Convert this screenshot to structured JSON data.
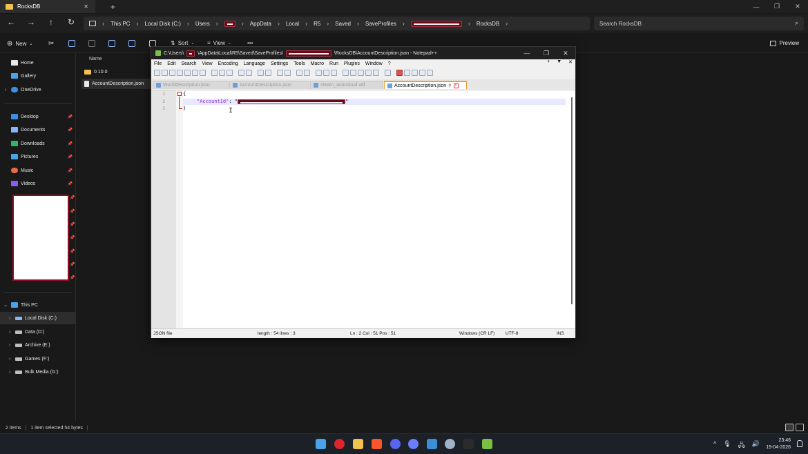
{
  "explorer": {
    "tab_title": "RocksDB",
    "tab_close": "✕",
    "new_tab": "+",
    "window_controls": {
      "minimize": "—",
      "maximize": "❐",
      "close": "✕"
    },
    "nav": {
      "back": "←",
      "forward": "→",
      "up": "↑",
      "refresh": "↻"
    },
    "breadcrumb": [
      "This PC",
      "Local Disk (C:)",
      "Users",
      "AppData",
      "Local",
      "R5",
      "Saved",
      "SaveProfiles",
      "RocksDB"
    ],
    "search_placeholder": "Search RocksDB",
    "toolbar": {
      "new_label": "New",
      "sort_label": "Sort",
      "view_label": "View",
      "more_label": "•••",
      "preview_label": "Preview"
    },
    "sidebar": {
      "quick": [
        {
          "label": "Home",
          "color": "#e8e8e8",
          "icon": "home-icon"
        },
        {
          "label": "Gallery",
          "color": "#4aa3e8",
          "icon": "gallery-icon"
        },
        {
          "label": "OneDrive",
          "color": "#3b8ee8",
          "icon": "cloud-icon"
        }
      ],
      "pinned": [
        {
          "label": "Desktop",
          "color": "#3b8ee8",
          "icon": "desktop-icon"
        },
        {
          "label": "Documents",
          "color": "#8ab4f8",
          "icon": "documents-icon"
        },
        {
          "label": "Downloads",
          "color": "#2fb36d",
          "icon": "downloads-icon"
        },
        {
          "label": "Pictures",
          "color": "#4aa3e8",
          "icon": "pictures-icon"
        },
        {
          "label": "Music",
          "color": "#e46a4a",
          "icon": "music-icon"
        },
        {
          "label": "Videos",
          "color": "#8a5cf0",
          "icon": "videos-icon"
        }
      ],
      "pin_glyph": "📌",
      "this_pc": "This PC",
      "drives": [
        {
          "label": "Local Disk (C:)",
          "selected": true
        },
        {
          "label": "Data (D:)",
          "selected": false
        },
        {
          "label": "Archive (E:)",
          "selected": false
        },
        {
          "label": "Games (F:)",
          "selected": false
        },
        {
          "label": "Bulk Media (G:)",
          "selected": false
        }
      ]
    },
    "files": {
      "column_name": "Name",
      "rows": [
        {
          "name": "0.10.0",
          "type": "folder",
          "selected": false
        },
        {
          "name": "AccountDescription.json",
          "type": "file",
          "selected": true
        }
      ]
    },
    "status": {
      "items": "2 items",
      "selected": "1 item selected  54 bytes"
    }
  },
  "notepad": {
    "title_prefix": "C:\\Users\\",
    "title_mid": "\\AppData\\Local\\R5\\Saved\\SaveProfiles\\",
    "title_suffix": "\\RocksDB\\AccountDescription.json - Notepad++",
    "menu": [
      "File",
      "Edit",
      "Search",
      "View",
      "Encoding",
      "Language",
      "Settings",
      "Tools",
      "Macro",
      "Run",
      "Plugins",
      "Window",
      "?"
    ],
    "menu_right": [
      "+",
      "▼",
      "✕"
    ],
    "tabs": [
      {
        "label": "WorldDescription.json",
        "active": false
      },
      {
        "label": "AccountDescription.json",
        "active": false
      },
      {
        "label": "steam_autocloud.vdf",
        "active": false
      },
      {
        "label": "AccountDescription.json",
        "active": true
      }
    ],
    "lines": [
      {
        "num": "1",
        "text": "{"
      },
      {
        "num": "2",
        "key": "\"AccountId\"",
        "sep": ": \"",
        "end": "\""
      },
      {
        "num": "3",
        "text": "}"
      }
    ],
    "status": {
      "filetype": "JSON file",
      "length": "length : 54    lines : 3",
      "position": "Ln : 2    Col : 51    Pos : 51",
      "eol": "Windows (CR LF)",
      "encoding": "UTF-8",
      "mode": "INS"
    }
  },
  "taskbar": {
    "time": "23:46",
    "date": "19-04-2026",
    "apps": [
      {
        "name": "start",
        "color": "#4aa3e8"
      },
      {
        "name": "opera",
        "color": "#e0242f"
      },
      {
        "name": "explorer",
        "color": "#f2c14e"
      },
      {
        "name": "brave",
        "color": "#fb542b"
      },
      {
        "name": "discord",
        "color": "#5865f2"
      },
      {
        "name": "app-arrow",
        "color": "#6b7cff"
      },
      {
        "name": "vs",
        "color": "#3a8fd8"
      },
      {
        "name": "steam",
        "color": "#9fb3c8"
      },
      {
        "name": "game",
        "color": "#2b2b2b"
      },
      {
        "name": "notepadpp",
        "color": "#7bc043"
      }
    ],
    "tray": [
      "^",
      "🎙",
      "🖧",
      "🔊"
    ]
  }
}
